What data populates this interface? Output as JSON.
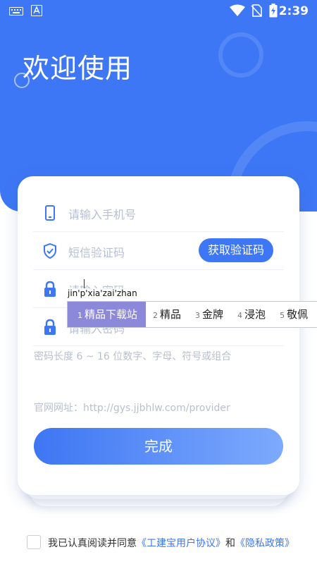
{
  "status_bar": {
    "time": "2:39"
  },
  "header": {
    "welcome": "欢迎使用"
  },
  "form": {
    "phone_placeholder": "请输入手机号",
    "sms_placeholder": "短信验证码",
    "get_code_label": "获取验证码",
    "password_placeholder": "请输入密码",
    "confirm_placeholder": "请输入密码",
    "password_hint": "密码长度 6 ~ 16 位数字、字母、符号或组合",
    "website": "官网网址：http://gys.jjbhlw.com/provider",
    "done_label": "完成"
  },
  "ime": {
    "composition": "jin'p'xia'zai'zhan",
    "candidates": [
      {
        "n": "1",
        "text": "精品下载站"
      },
      {
        "n": "2",
        "text": "精品"
      },
      {
        "n": "3",
        "text": "金牌"
      },
      {
        "n": "4",
        "text": "浸泡"
      },
      {
        "n": "5",
        "text": "敬佩"
      }
    ]
  },
  "agreement": {
    "prefix": "我已认真阅读并同意",
    "user_agreement": "《工建宝用户协议》",
    "and": "和",
    "privacy_policy": "《隐私政策》"
  },
  "colors": {
    "primary": "#3D77F5",
    "ime_selected": "#8C89DB",
    "placeholder": "#b6bfd4"
  }
}
